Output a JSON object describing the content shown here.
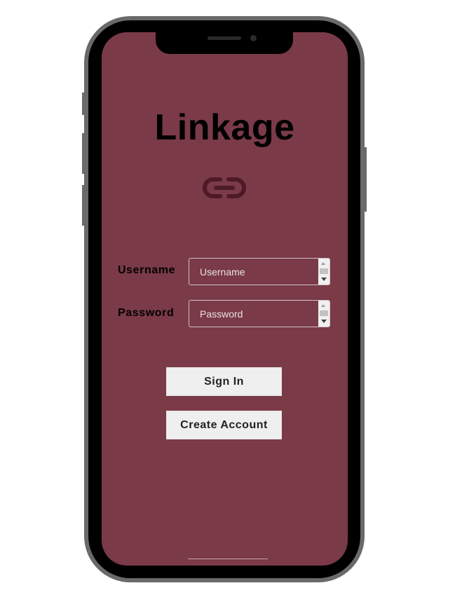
{
  "app": {
    "title": "Linkage",
    "logo_icon": "link-icon"
  },
  "colors": {
    "screen_background": "#7b3a48",
    "icon_color": "#4e1a26",
    "phone_frame": "#6a6a6a"
  },
  "form": {
    "username": {
      "label": "Username",
      "placeholder": "Username",
      "value": ""
    },
    "password": {
      "label": "Password",
      "placeholder": "Password",
      "value": ""
    }
  },
  "buttons": {
    "sign_in": "Sign In",
    "create_account": "Create Account"
  }
}
